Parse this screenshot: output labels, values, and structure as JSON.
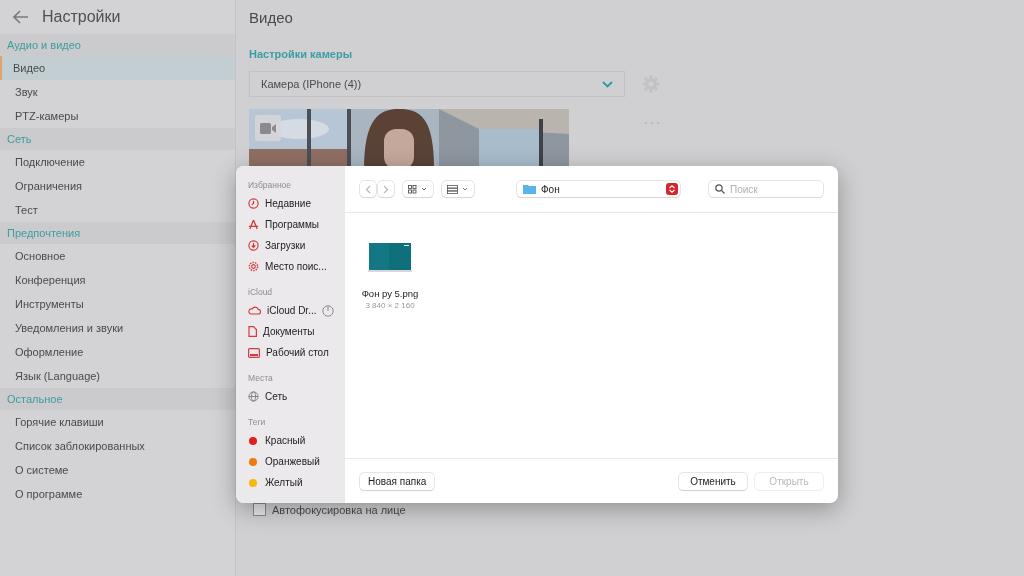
{
  "settings": {
    "title": "Настройки",
    "sections": [
      {
        "title": "Аудио и видео",
        "items": [
          {
            "label": "Видео",
            "selected": true
          },
          {
            "label": "Звук",
            "selected": false
          },
          {
            "label": "PTZ-камеры",
            "selected": false
          }
        ]
      },
      {
        "title": "Сеть",
        "items": [
          {
            "label": "Подключение",
            "selected": false
          },
          {
            "label": "Ограничения",
            "selected": false
          },
          {
            "label": "Тест",
            "selected": false
          }
        ]
      },
      {
        "title": "Предпочтения",
        "items": [
          {
            "label": "Основное",
            "selected": false
          },
          {
            "label": "Конференция",
            "selected": false
          },
          {
            "label": "Инструменты",
            "selected": false
          },
          {
            "label": "Уведомления и звуки",
            "selected": false
          },
          {
            "label": "Оформление",
            "selected": false
          },
          {
            "label": "Язык (Language)",
            "selected": false
          }
        ]
      },
      {
        "title": "Остальное",
        "items": [
          {
            "label": "Горячие клавиши",
            "selected": false
          },
          {
            "label": "Список заблокированных",
            "selected": false
          },
          {
            "label": "О системе",
            "selected": false
          },
          {
            "label": "О программе",
            "selected": false
          }
        ]
      }
    ]
  },
  "page": {
    "title": "Видео",
    "section": "Настройки камеры",
    "camera_select": {
      "value": "Камера (IPhone (4))"
    },
    "face_autofocus": {
      "label": "Автофокусировка на лице",
      "checked": false
    }
  },
  "file_dialog": {
    "sidebar": [
      {
        "title": "Избранное",
        "items": [
          {
            "label": "Недавние",
            "kind": "recent",
            "selected": false
          },
          {
            "label": "Программы",
            "kind": "apps",
            "selected": false
          },
          {
            "label": "Загрузки",
            "kind": "downloads",
            "selected": false
          },
          {
            "label": "Место поис...",
            "kind": "gear",
            "selected": false
          }
        ]
      },
      {
        "title": "iCloud",
        "items": [
          {
            "label": "iCloud Dr...",
            "kind": "cloud",
            "syncing": true,
            "selected": false
          },
          {
            "label": "Документы",
            "kind": "document",
            "selected": false
          },
          {
            "label": "Рабочий стол",
            "kind": "desktop",
            "selected": false
          }
        ]
      },
      {
        "title": "Места",
        "items": [
          {
            "label": "Сеть",
            "kind": "network",
            "selected": false
          }
        ]
      },
      {
        "title": "Теги",
        "items": [
          {
            "label": "Красный",
            "kind": "tag",
            "color": "#e0201c",
            "selected": false
          },
          {
            "label": "Оранжевый",
            "kind": "tag",
            "color": "#f07a12",
            "selected": false
          },
          {
            "label": "Желтый",
            "kind": "tag",
            "color": "#f2b90f",
            "selected": false
          }
        ]
      }
    ],
    "location": "Фон",
    "search": {
      "placeholder": "Поиск"
    },
    "files": [
      {
        "name": "Фон ру 5.png",
        "dimensions": "3 840 × 2 160",
        "selected": false
      }
    ],
    "buttons": [
      {
        "label": "Новая папка",
        "kind": "secondary",
        "disabled": false
      },
      {
        "label": "Отменить",
        "kind": "cancel",
        "disabled": false
      },
      {
        "label": "Открыть",
        "kind": "primary",
        "disabled": true
      }
    ]
  }
}
